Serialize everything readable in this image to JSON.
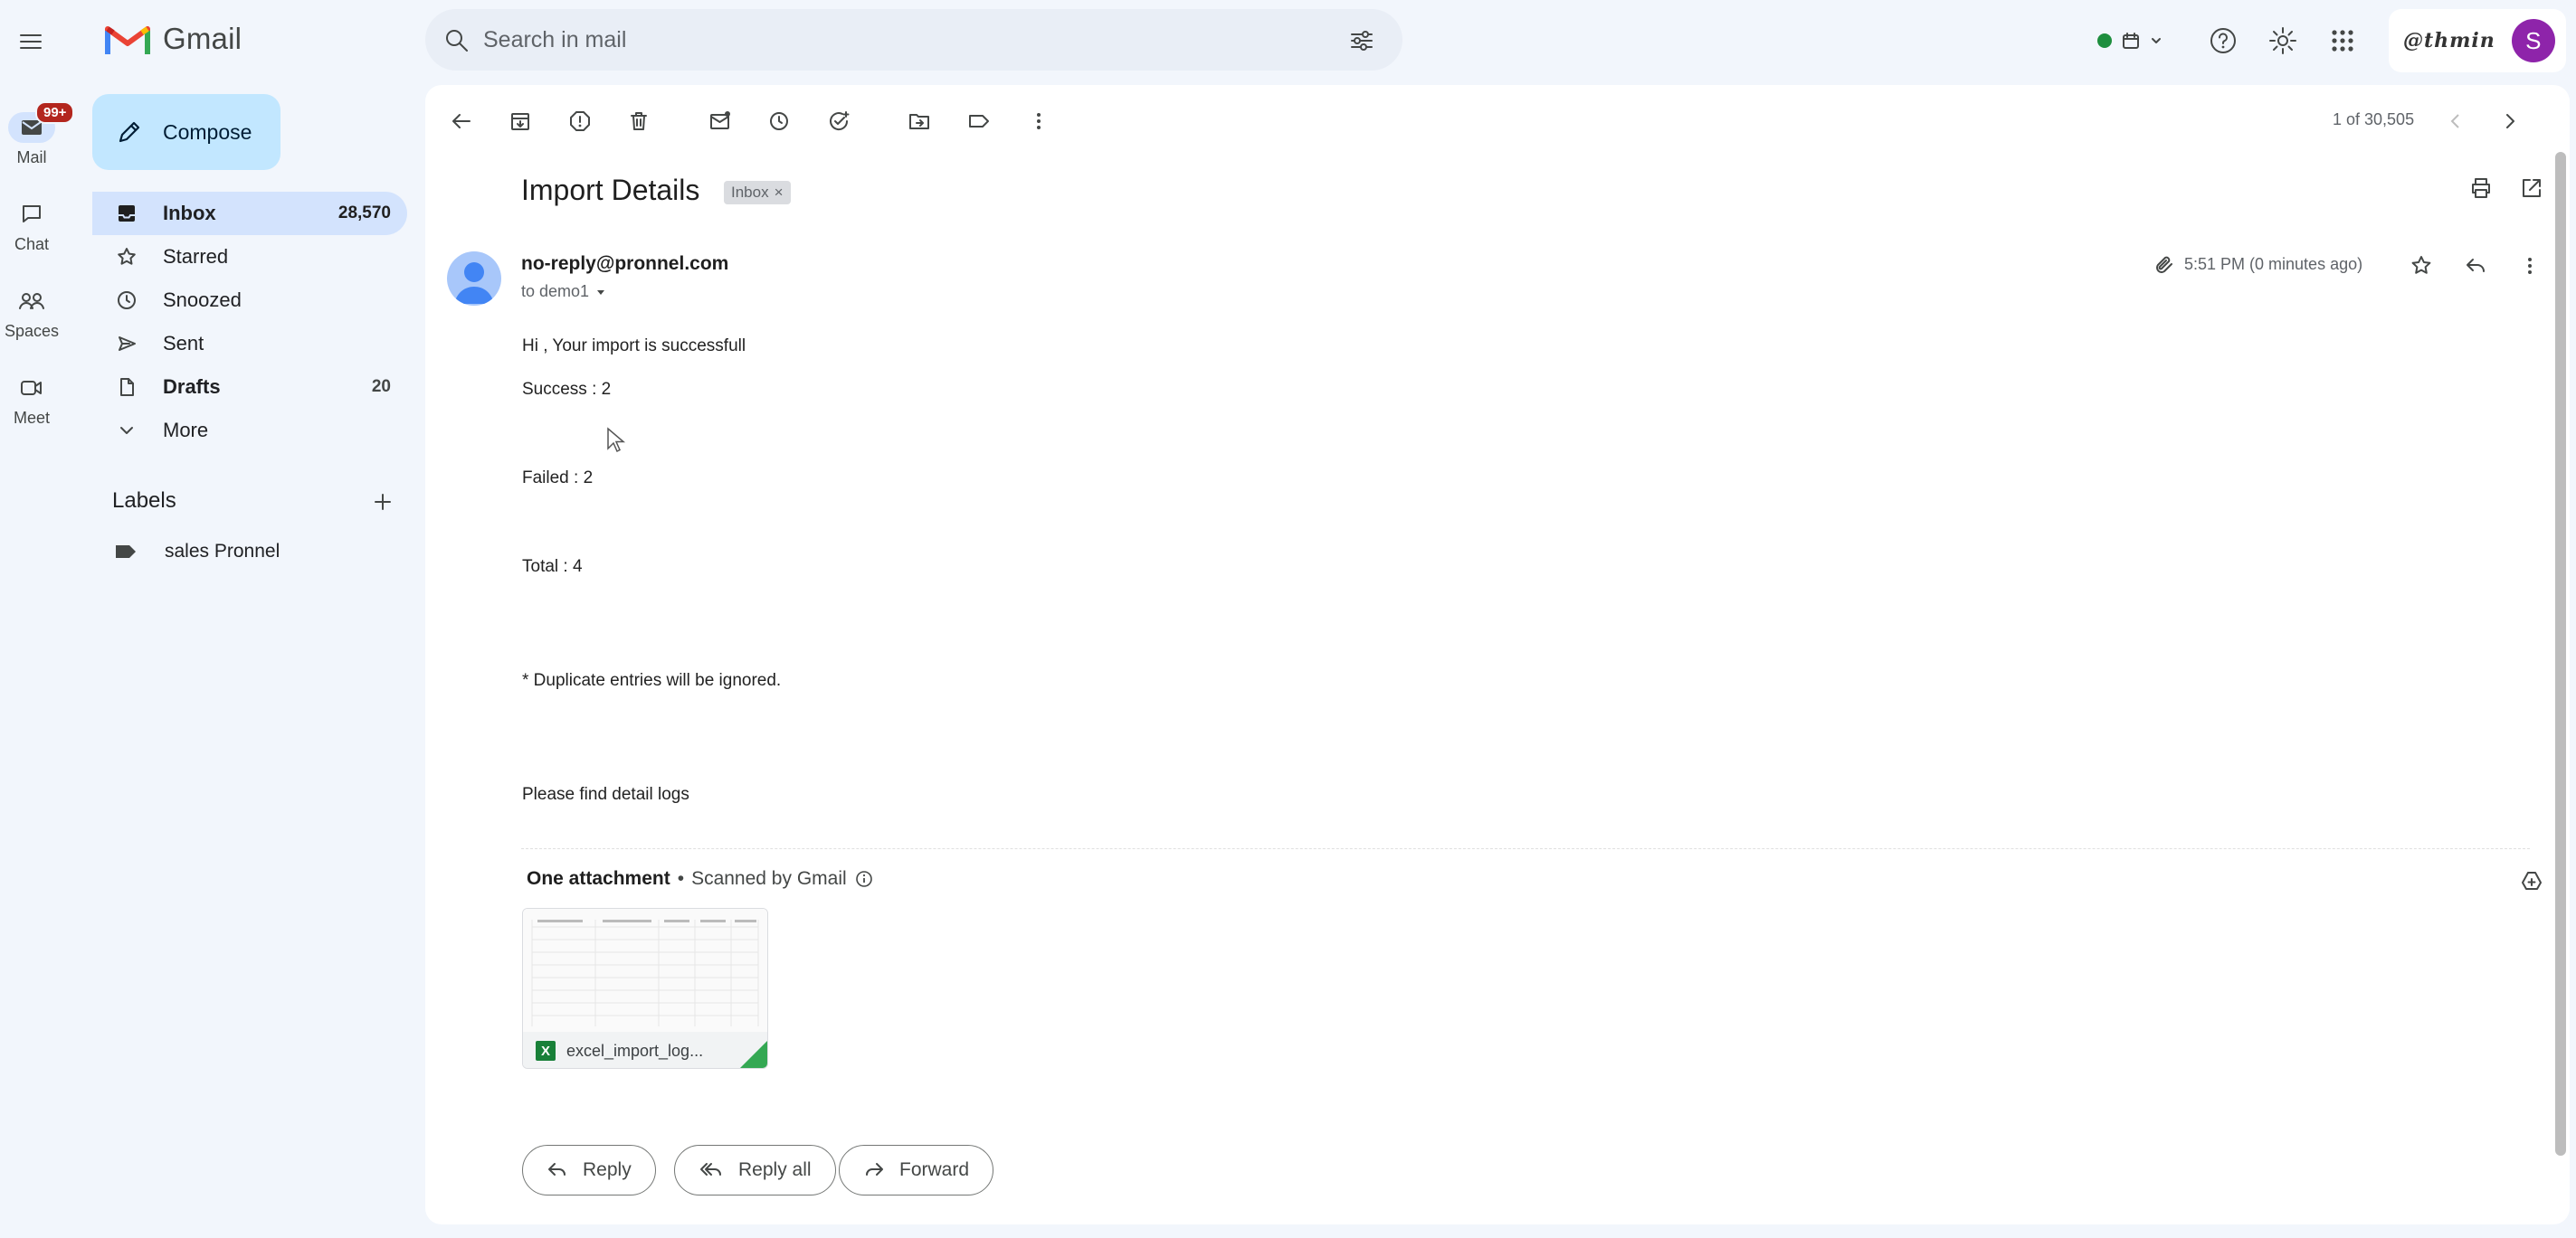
{
  "app": {
    "name": "Gmail"
  },
  "search": {
    "placeholder": "Search in mail"
  },
  "brand": {
    "name": "@thmin",
    "avatar_letter": "S"
  },
  "rail": {
    "mail": {
      "label": "Mail",
      "badge": "99+"
    },
    "chat": {
      "label": "Chat"
    },
    "spaces": {
      "label": "Spaces"
    },
    "meet": {
      "label": "Meet"
    }
  },
  "compose": {
    "label": "Compose"
  },
  "nav": {
    "inbox": {
      "label": "Inbox",
      "count": "28,570"
    },
    "starred": {
      "label": "Starred"
    },
    "snoozed": {
      "label": "Snoozed"
    },
    "sent": {
      "label": "Sent"
    },
    "drafts": {
      "label": "Drafts",
      "count": "20"
    },
    "more": {
      "label": "More"
    }
  },
  "labels": {
    "heading": "Labels",
    "items": [
      "sales Pronnel"
    ]
  },
  "pager": {
    "text": "1 of 30,505"
  },
  "email": {
    "subject": "Import Details",
    "chip": "Inbox",
    "chip_close": "×",
    "sender": "no-reply@pronnel.com",
    "to": "to demo1",
    "time": "5:51 PM (0 minutes ago)",
    "body": {
      "greeting": "Hi , Your import is successfull",
      "success": "Success : 2",
      "failed": "Failed : 2",
      "total": "Total : 4",
      "note": "* Duplicate entries will be ignored.",
      "logs": "Please find detail logs"
    },
    "attachment": {
      "title": "One attachment",
      "separator": "•",
      "scan": "Scanned by Gmail",
      "filename": "excel_import_log...",
      "file_type": "X"
    }
  },
  "actions": {
    "reply": "Reply",
    "reply_all": "Reply all",
    "forward": "Forward"
  },
  "colors": {
    "background": "#f2f6fc",
    "compose": "#c2e7ff",
    "active": "#d3e3fd",
    "badge": "#b3261e",
    "avatar": "#8e24aa",
    "status": "#1e8e3e"
  },
  "icons": {
    "rail": [
      "mail-icon",
      "chat-icon",
      "spaces-icon",
      "meet-icon"
    ],
    "toolbar": [
      "back-arrow-icon",
      "archive-icon",
      "report-spam-icon",
      "delete-icon",
      "mark-unread-icon",
      "snooze-icon",
      "add-task-icon",
      "move-to-icon",
      "label-icon",
      "more-vert-icon"
    ]
  }
}
